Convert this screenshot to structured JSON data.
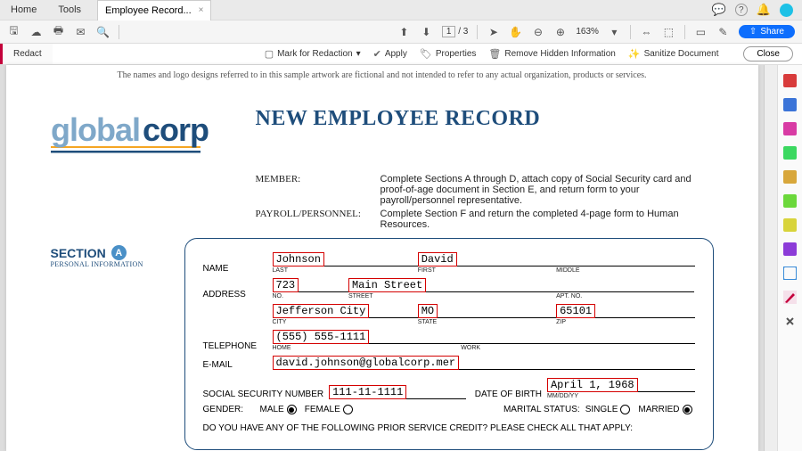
{
  "tabs": {
    "home": "Home",
    "tools": "Tools",
    "doc": "Employee Record...",
    "close": "×"
  },
  "topicons": {
    "chat": "💬",
    "help": "?",
    "bell": "🔔"
  },
  "paging": {
    "cur": "1",
    "sep": "/",
    "tot": "3"
  },
  "zoom": "163%",
  "share": "Share",
  "redact": {
    "tab": "Redact",
    "mark": "Mark for Redaction",
    "apply": "Apply",
    "props": "Properties",
    "remove": "Remove Hidden Information",
    "san": "Sanitize Document",
    "close": "Close"
  },
  "disclaimer": "The names and logo designs referred to in this sample artwork are fictional and not intended to refer to any actual organization, products or services.",
  "logo": {
    "a": "global",
    "b": "corp"
  },
  "title": "NEW EMPLOYEE RECORD",
  "instr": {
    "memberLab": "MEMBER:",
    "memberTxt": "Complete Sections A through D, attach copy of Social Security card and proof-of-age document in Section E, and return form to your payroll/personnel representative.",
    "payLab": "PAYROLL/PERSONNEL:",
    "payTxt": "Complete Section F and return the completed 4-page form to Human Resources."
  },
  "section": {
    "title": "SECTION",
    "letter": "A",
    "sub": "PERSONAL INFORMATION"
  },
  "form": {
    "name": {
      "lab": "NAME",
      "last": "Johnson",
      "lastTiny": "LAST",
      "first": "David",
      "firstTiny": "FIRST",
      "middleTiny": "MIDDLE"
    },
    "addr": {
      "lab": "ADDRESS",
      "no": "723",
      "noTiny": "NO.",
      "street": "Main Street",
      "streetTiny": "STREET",
      "aptTiny": "APT. NO.",
      "city": "Jefferson City",
      "cityTiny": "CITY",
      "state": "MO",
      "stateTiny": "STATE",
      "zip": "65101",
      "zipTiny": "ZIP"
    },
    "tel": {
      "lab": "TELEPHONE",
      "home": "(555) 555-1111",
      "homeTiny": "HOME",
      "workTiny": "WORK"
    },
    "email": {
      "lab": "E-MAIL",
      "val": "david.johnson@globalcorp.mer"
    },
    "ssn": {
      "lab": "SOCIAL SECURITY NUMBER",
      "val": "111-11-1111"
    },
    "dob": {
      "lab": "DATE OF BIRTH",
      "val": "April 1, 1968",
      "tiny": "MM/DD/YY"
    },
    "gender": {
      "lab": "GENDER:",
      "m": "MALE",
      "f": "FEMALE"
    },
    "marital": {
      "lab": "MARITAL STATUS:",
      "s": "SINGLE",
      "m": "MARRIED"
    },
    "prior": "DO YOU HAVE ANY OF THE FOLLOWING PRIOR SERVICE CREDIT? PLEASE CHECK ALL THAT APPLY:"
  }
}
